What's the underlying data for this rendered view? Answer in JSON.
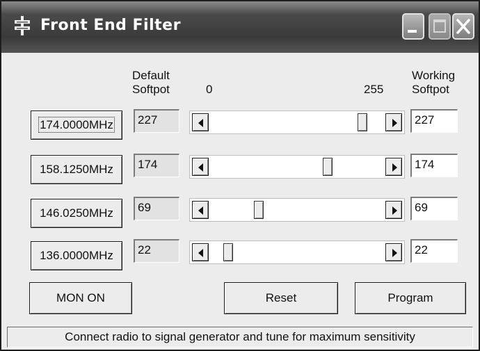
{
  "window": {
    "title": "Front End Filter"
  },
  "labels": {
    "default_softpot_1": "Default",
    "default_softpot_2": "Softpot",
    "scale_min": "0",
    "scale_max": "255",
    "working_softpot_1": "Working",
    "working_softpot_2": "Softpot"
  },
  "rows": [
    {
      "freq": "174.0000MHz",
      "default": "227",
      "working": "227",
      "slider_value": 227
    },
    {
      "freq": "158.1250MHz",
      "default": "174",
      "working": "174",
      "slider_value": 174
    },
    {
      "freq": "146.0250MHz",
      "default": "69",
      "working": "69",
      "slider_value": 69
    },
    {
      "freq": "136.0000MHz",
      "default": "22",
      "working": "22",
      "slider_value": 22
    }
  ],
  "slider_range": [
    0,
    255
  ],
  "buttons": {
    "mon_on": "MON ON",
    "reset": "Reset",
    "program": "Program"
  },
  "status": "Connect radio to signal generator and tune for maximum sensitivity",
  "icons": [
    "app-icon",
    "minimize-icon",
    "maximize-icon",
    "close-icon",
    "arrow-left-icon",
    "arrow-right-icon"
  ]
}
